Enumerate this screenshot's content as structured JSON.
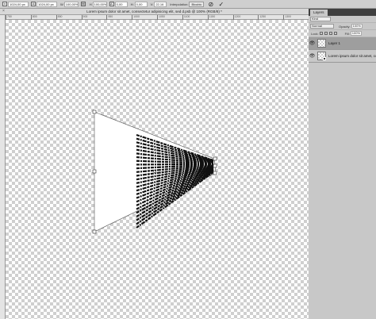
{
  "options_bar": {
    "x_value": "1024,00 px",
    "y_value": "1024,00 px",
    "w_value": "100,00%",
    "h_value": "100,00%",
    "angle_value": "0,00",
    "h_skew_value": "0,00",
    "v_skew_value": "22,16",
    "interpolation_label": "Interpolation:",
    "interpolation_value": "Bicubic",
    "cancel_icon": "cancel-transform-icon",
    "commit_icon": "checkmark-icon"
  },
  "document": {
    "title": "Lorem ipsum dolor sit amet, consectetur adipisicing elit, sed d.psb @ 100% (RGB/8) *",
    "close_glyph": "×"
  },
  "ruler": {
    "ticks": [
      "750",
      "800",
      "850",
      "900",
      "950",
      "1000",
      "1050",
      "1100",
      "1150",
      "1200",
      "1250",
      "1300"
    ]
  },
  "layers_panel": {
    "tab_label": "Layers",
    "filter_label": "Kind",
    "blend_mode": "Normal",
    "opacity_label": "Opacity:",
    "opacity_value": "100%",
    "lock_label": "Lock:",
    "fill_label": "Fill:",
    "fill_value": "100%",
    "layers": [
      {
        "name": "Layer 1",
        "visible_glyph": "👁"
      },
      {
        "name": "Lorem ipsum dolor sit amet, consectetur",
        "visible_glyph": "👁"
      }
    ]
  },
  "colors": {
    "accent": "#9e9e9e",
    "panel_bg": "#c8c8c8",
    "app_bg": "#535353"
  }
}
